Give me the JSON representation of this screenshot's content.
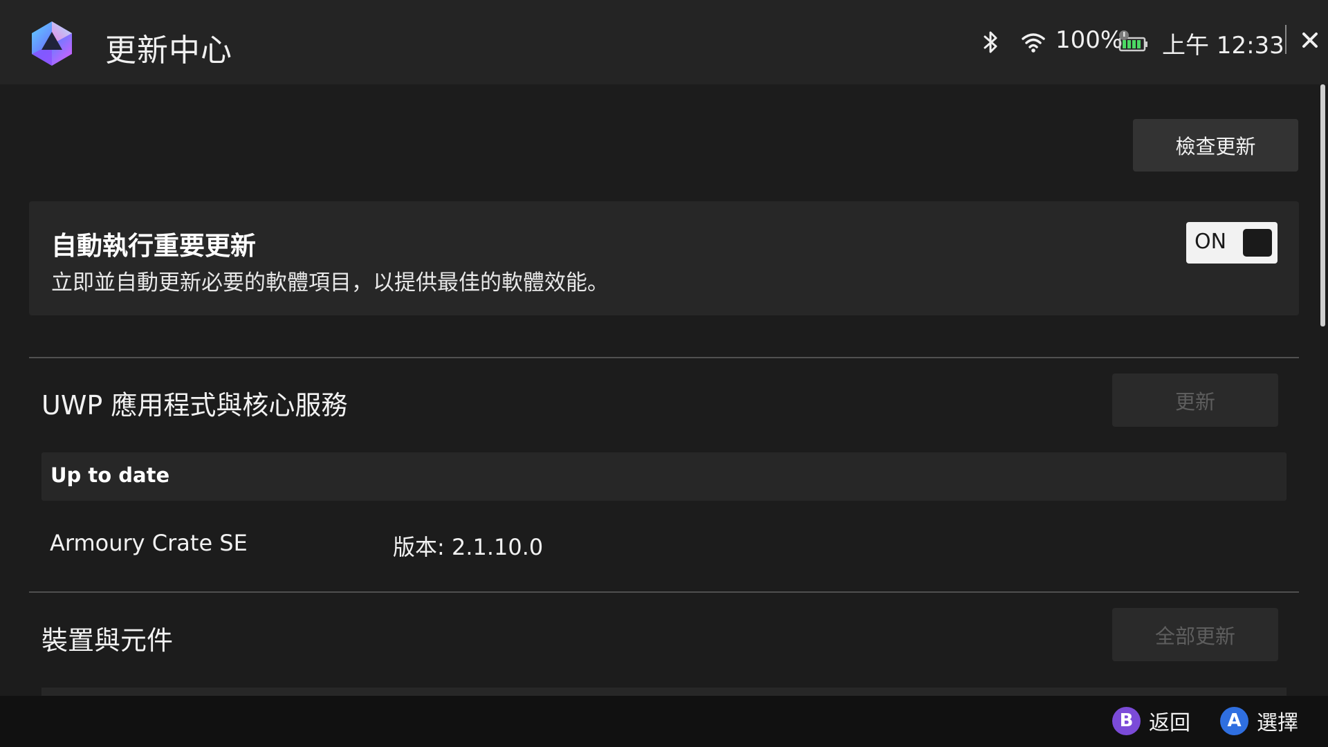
{
  "header": {
    "title": "更新中心",
    "battery_percent": "100%",
    "time": "上午 12:33"
  },
  "toolbar": {
    "check_updates_label": "檢查更新"
  },
  "auto_update": {
    "title": "自動執行重要更新",
    "description": "立即並自動更新必要的軟體項目，以提供最佳的軟體效能。",
    "toggle_label": "ON",
    "enabled": true
  },
  "uwp_section": {
    "title": "UWP 應用程式與核心服務",
    "update_button_label": "更新",
    "status": "Up to date",
    "items": [
      {
        "name": "Armoury Crate SE",
        "version": "版本: 2.1.10.0"
      }
    ]
  },
  "devices_section": {
    "title": "裝置與元件",
    "update_all_button_label": "全部更新"
  },
  "footer": {
    "hints": [
      {
        "button": "B",
        "label": "返回",
        "color": "#7b4bd8"
      },
      {
        "button": "A",
        "label": "選擇",
        "color": "#2f6fe0"
      }
    ]
  },
  "colors": {
    "background": "#1c1c1c",
    "header_background": "#242424",
    "card_background": "#272727",
    "footer_background": "#111111",
    "battery_green": "#4cd964"
  },
  "icons": {
    "app_logo": "armoury-crate-logo",
    "bluetooth": "bluetooth-icon",
    "wifi": "wifi-icon",
    "battery": "battery-icon",
    "close": "close-icon"
  }
}
